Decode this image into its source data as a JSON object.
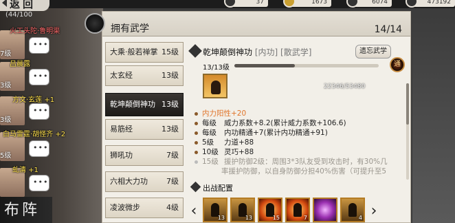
{
  "top": {
    "back_label": "返回",
    "resources": [
      "37",
      "1673",
      "6074",
      "473192"
    ]
  },
  "team": {
    "count": "(44/100",
    "members": [
      {
        "name": "火工头陀·鲁明渠",
        "level": "7级",
        "color": "#ff6b6b"
      },
      {
        "name": "吕晨露",
        "level": "3级",
        "color": "#ffe14d"
      },
      {
        "name": "方文·玄莲 +1",
        "level": "3级",
        "color": "#ffe14d"
      },
      {
        "name": "白马雷霆·胡怪齐 +2",
        "level": "5级",
        "color": "#ffe14d"
      },
      {
        "name": "虬清 +1",
        "level": "",
        "color": "#ffe14d"
      }
    ],
    "formation_label": "布阵"
  },
  "panel": {
    "title": "拥有武学",
    "count": "14/14"
  },
  "skills": [
    {
      "name": "大乘·般若禅掌",
      "level": "15级",
      "active": false
    },
    {
      "name": "太玄经",
      "level": "13级",
      "active": false
    },
    {
      "name": "乾坤颠倒神功",
      "level": "13级",
      "active": true
    },
    {
      "name": "易筋经",
      "level": "13级",
      "active": false
    },
    {
      "name": "狮吼功",
      "level": "7级",
      "active": false
    },
    {
      "name": "六相大力功",
      "level": "7级",
      "active": false
    },
    {
      "name": "凌波微步",
      "level": "4级",
      "active": false
    }
  ],
  "detail": {
    "name": "乾坤颠倒神功",
    "tags": "[内功] [散武学]",
    "forget_label": "遗忘武学",
    "progress_text": "13/13级",
    "progress_value": "22346/53480",
    "progress_fraction": 0.42,
    "transcend_label": "通",
    "attributes": [
      {
        "level": "",
        "text": "内力阳性+20",
        "style": "accent",
        "color": "#e0752b"
      },
      {
        "level": "每级",
        "text": "威力系数+8.2(累计威力系数+106.6)",
        "style": "normal"
      },
      {
        "level": "每级",
        "text": "内功精通+7(累计内功精通+91)",
        "style": "normal"
      },
      {
        "level": "5级",
        "text": "力道+88",
        "style": "normal"
      },
      {
        "level": "10级",
        "text": "灵巧+88",
        "style": "normal"
      },
      {
        "level": "15级",
        "text": "援护防御2级：周围3*3队友受到攻击时，有30%几",
        "style": "dim"
      },
      {
        "level": "",
        "text": "率援护防御，以自身防御分担40%伤害（可提升至5",
        "style": "dim"
      }
    ],
    "deploy_label": "出战配置",
    "slots": [
      {
        "num": "13",
        "style": "gold"
      },
      {
        "num": "13",
        "style": "gold"
      },
      {
        "num": "15",
        "style": "gold"
      },
      {
        "num": "7",
        "style": "fire"
      },
      {
        "num": "",
        "style": "purple"
      },
      {
        "num": "4",
        "style": "gold"
      }
    ]
  }
}
